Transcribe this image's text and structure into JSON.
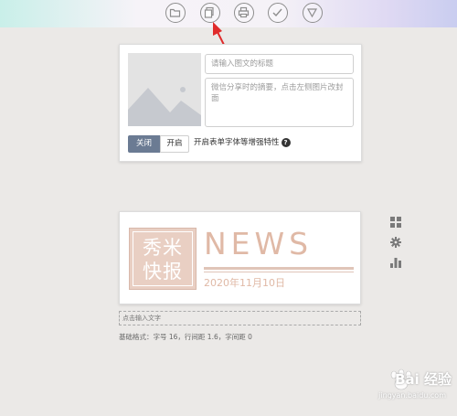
{
  "toolbar": {
    "buttons": [
      {
        "name": "folder-button",
        "icon": "folder-icon"
      },
      {
        "name": "copy-button",
        "icon": "copy-icon"
      },
      {
        "name": "print-button",
        "icon": "printer-icon"
      },
      {
        "name": "confirm-button",
        "icon": "check-icon"
      },
      {
        "name": "more-button",
        "icon": "triangle-down-icon"
      }
    ]
  },
  "cover_card": {
    "title_placeholder": "请输入图文的标题",
    "summary_placeholder": "微信分享时的摘要，点击左侧图片改封面",
    "toggle_off_label": "关闭",
    "toggle_on_label": "开启",
    "toggle_selected": "关闭",
    "feature_label": "开启表单字体等增强特性",
    "help_symbol": "?"
  },
  "template_card": {
    "stamp_line1": "秀米",
    "stamp_line2": "快报",
    "headline": "NEWS",
    "date": "2020年11月10日",
    "accent_color": "#e0b9a6"
  },
  "text_input_hint": "点击输入文字",
  "format_info": "基础格式：字号 16，行间距 1.6，字间距 0",
  "side_tools": [
    {
      "name": "grid-tool",
      "icon": "grid-icon"
    },
    {
      "name": "gear-tool",
      "icon": "gear-icon"
    },
    {
      "name": "chart-tool",
      "icon": "bar-chart-icon"
    }
  ],
  "watermark": {
    "text": "Bai 经验",
    "url": "jingyan.baidu.com"
  },
  "colors": {
    "background": "#ebe9e7",
    "toggle_active": "#6b7b93",
    "arrow": "#e02b2b"
  }
}
